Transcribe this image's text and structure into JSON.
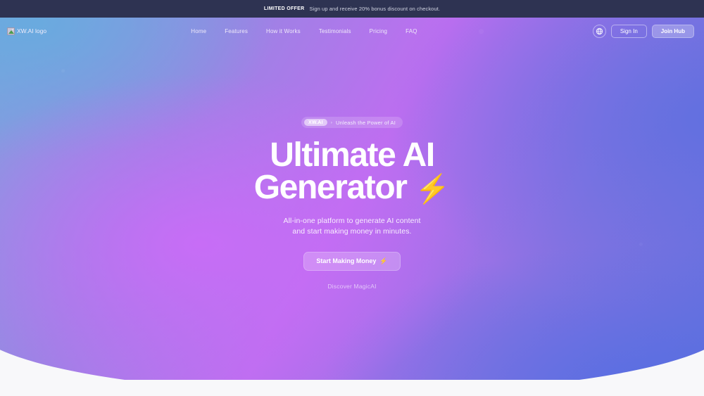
{
  "announcement": {
    "label": "LIMITED OFFER",
    "text": "Sign up and receive 20% bonus discount on checkout."
  },
  "navbar": {
    "logo_alt": "XW.AI logo",
    "logo_icon": "broken-image-icon",
    "links": [
      {
        "label": "Home"
      },
      {
        "label": "Features"
      },
      {
        "label": "How it Works"
      },
      {
        "label": "Testimonials"
      },
      {
        "label": "Pricing"
      },
      {
        "label": "FAQ"
      }
    ],
    "language_icon": "globe-icon",
    "sign_in_label": "Sign In",
    "join_hub_label": "Join Hub"
  },
  "hero": {
    "eyebrow_chip": "XW.AI",
    "eyebrow_arrow": "›",
    "eyebrow_text": "Unleash the Power of AI",
    "headline_line1": "Ultimate AI",
    "headline_line2": "Generator",
    "headline_bolt": "⚡",
    "subhead_line1": "All-in-one platform to generate AI content",
    "subhead_line2": "and start making money in minutes.",
    "cta_label": "Start Making Money",
    "cta_bolt": "⚡",
    "secondary_link": "Discover MagicAI"
  },
  "colors": {
    "announcement_bg": "#2e3352",
    "gradient_blue": "#79a7dd",
    "gradient_magenta": "#bd6ef0",
    "gradient_indigo": "#5f70dd",
    "page_bg": "#f8f8fa",
    "text_on_hero": "#ffffff"
  }
}
